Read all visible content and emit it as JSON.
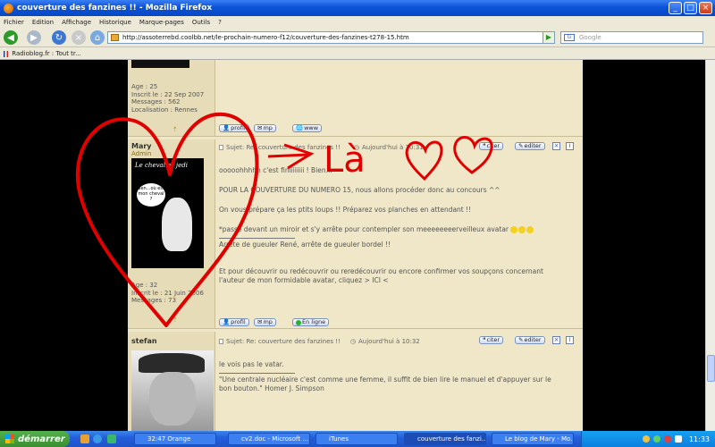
{
  "window": {
    "title": "couverture des fanzines !! - Mozilla Firefox"
  },
  "menu": [
    "Fichier",
    "Edition",
    "Affichage",
    "Historique",
    "Marque-pages",
    "Outils",
    "?"
  ],
  "nav": {
    "url": "http://assoterrebd.coolbb.net/le-prochain-numero-f12/couverture-des-fanzines-t278-15.htm",
    "search_placeholder": "Google"
  },
  "bookmark": {
    "label": "Radioblog.fr : Tout tr..."
  },
  "post_prev": {
    "age": "Age : 25",
    "joined": "Inscrit le : 22 Sep 2007",
    "messages": "Messages : 562",
    "location": "Localisation : Rennes",
    "buttons": [
      "profil",
      "mp",
      "www"
    ]
  },
  "post_mary": {
    "username": "Mary",
    "role": "Admin",
    "avatar_title": "Le chevalier jedi",
    "avatar_bubble": "Ben...où est mon cheval ?",
    "subject": "Sujet: Re: couverture des fanzines !!",
    "time": "Aujourd'hui à 10:31",
    "lines": [
      "ooooohhhhh c'est finiiiiiiii ! Bien...",
      "POUR LA COUVERTURE DU NUMERO 15, nous allons procéder donc au concours ^^",
      "On vous prépare ça les ptits loups !! Préparez vos planches en attendant !!",
      "*passe devant un miroir et s'y arrête pour contempler son meeeeeeeerveilleux avatar",
      "Arrête de gueuler René, arrête de gueuler bordel !!",
      "Et pour découvrir ou redécouvrir ou reredécouvrir ou encore confirmer vos soupçons concernant",
      "l'auteur de mon formidable avatar, cliquez > ICI <"
    ],
    "age": "Age : 32",
    "joined": "Inscrit le : 21 Juin 2006",
    "messages": "Messages : 73",
    "buttons": [
      "profil",
      "mp",
      "En ligne"
    ],
    "action_buttons": [
      "citer",
      "editer"
    ]
  },
  "post_stefan": {
    "username": "stefan",
    "subject": "Sujet: Re: couverture des fanzines !!",
    "time": "Aujourd'hui à 10:32",
    "lines": [
      "le vois pas le vatar.",
      "\"Une centrale nucléaire c'est comme une femme, il suffit de bien lire le manuel et d'appuyer sur le",
      "bon bouton.\" Homer J. Simpson"
    ],
    "action_buttons": [
      "citer",
      "editer"
    ]
  },
  "annotation": {
    "text": "Là"
  },
  "taskbar": {
    "start": "démarrer",
    "items": [
      "32:47 Orange",
      "cv2.doc - Microsoft ...",
      "iTunes",
      "couverture des fanzi...",
      "Le blog de Mary - Mo..."
    ],
    "clock": "11:33"
  }
}
